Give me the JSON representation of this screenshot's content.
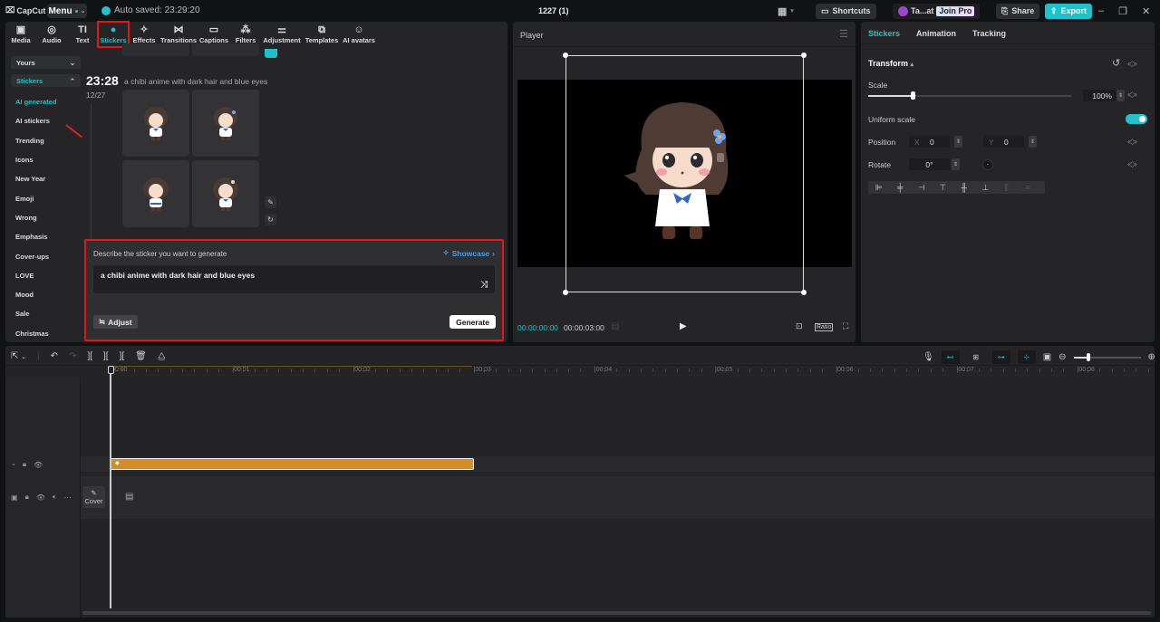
{
  "titlebar": {
    "app_name": "CapCut",
    "menu_label": "Menu",
    "autosave_text": "Auto saved: 23:29:20",
    "project_title": "1227 (1)",
    "shortcuts_label": "Shortcuts",
    "user_name": "Ta...at",
    "join_pro_label": "Join Pro",
    "share_label": "Share",
    "export_label": "Export"
  },
  "toolbar": {
    "tabs": [
      {
        "label": "Media",
        "icon": "media-icon",
        "glyph": "▣"
      },
      {
        "label": "Audio",
        "icon": "audio-icon",
        "glyph": "◎"
      },
      {
        "label": "Text",
        "icon": "text-icon",
        "glyph": "TI"
      },
      {
        "label": "Stickers",
        "icon": "stickers-icon",
        "glyph": "●"
      },
      {
        "label": "Effects",
        "icon": "effects-icon",
        "glyph": "✧"
      },
      {
        "label": "Transitions",
        "icon": "transitions-icon",
        "glyph": "⋈"
      },
      {
        "label": "Captions",
        "icon": "captions-icon",
        "glyph": "▭"
      },
      {
        "label": "Filters",
        "icon": "filters-icon",
        "glyph": "⁂"
      },
      {
        "label": "Adjustment",
        "icon": "adjustment-icon",
        "glyph": "⚌"
      },
      {
        "label": "Templates",
        "icon": "templates-icon",
        "glyph": "⧉"
      },
      {
        "label": "AI avatars",
        "icon": "ai-avatars-icon",
        "glyph": "☺"
      }
    ],
    "active_tab": "Stickers"
  },
  "sidebar": {
    "yours_label": "Yours",
    "stickers_label": "Stickers",
    "items": [
      {
        "label": "AI generated",
        "active": true
      },
      {
        "label": "AI stickers"
      },
      {
        "label": "Trending"
      },
      {
        "label": "Icons"
      },
      {
        "label": "New Year"
      },
      {
        "label": "Emoji"
      },
      {
        "label": "Wrong"
      },
      {
        "label": "Emphasis"
      },
      {
        "label": "Cover-ups"
      },
      {
        "label": "LOVE"
      },
      {
        "label": "Mood"
      },
      {
        "label": "Sale"
      },
      {
        "label": "Christmas"
      }
    ]
  },
  "generation": {
    "time": "23:28",
    "date": "12/27",
    "prompt": "a chibi anime with dark hair and blue eyes",
    "result_count": 4
  },
  "generator": {
    "label": "Describe the sticker you want to generate",
    "showcase_label": "Showcase",
    "input_value": "a chibi anime with dark hair and blue eyes",
    "adjust_label": "Adjust",
    "generate_label": "Generate"
  },
  "player": {
    "title": "Player",
    "current_time": "00:00:00:00",
    "duration": "00:00:03:00",
    "ratio_label": "Ratio"
  },
  "properties": {
    "tabs": [
      "Stickers",
      "Animation",
      "Tracking"
    ],
    "active_tab": "Stickers",
    "section": "Transform",
    "scale_label": "Scale",
    "scale_value": "100%",
    "scale_fraction": 0.22,
    "uniform_scale_label": "Uniform scale",
    "uniform_scale_on": true,
    "position_label": "Position",
    "pos_x_label": "X",
    "pos_x": "0",
    "pos_y_label": "Y",
    "pos_y": "0",
    "rotate_label": "Rotate",
    "rotate_value": "0°"
  },
  "timeline": {
    "ruler": [
      "00:00",
      "00:01",
      "00:02",
      "00:03",
      "00:04",
      "00:05",
      "00:06",
      "00:07",
      "00:08"
    ],
    "cover_label": "Cover",
    "clip_duration_seconds": 3
  }
}
